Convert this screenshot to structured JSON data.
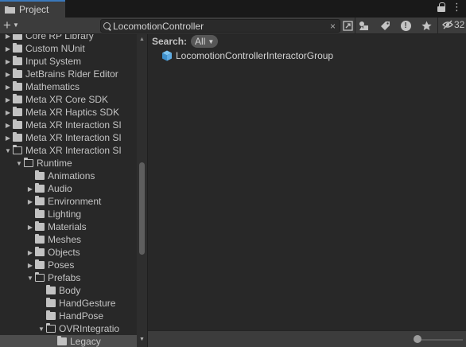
{
  "tab": {
    "label": "Project"
  },
  "toolbar": {
    "search_value": "LocomotionController",
    "clear_glyph": "×",
    "hidden_count": "32"
  },
  "tree": {
    "items": [
      {
        "label": "Core RP Library",
        "depth": 1,
        "expanded": false
      },
      {
        "label": "Custom NUnit",
        "depth": 1,
        "expanded": false
      },
      {
        "label": "Input System",
        "depth": 1,
        "expanded": false
      },
      {
        "label": "JetBrains Rider Editor",
        "depth": 1,
        "expanded": false
      },
      {
        "label": "Mathematics",
        "depth": 1,
        "expanded": false
      },
      {
        "label": "Meta XR Core SDK",
        "depth": 1,
        "expanded": false
      },
      {
        "label": "Meta XR Haptics SDK",
        "depth": 1,
        "expanded": false
      },
      {
        "label": "Meta XR Interaction SI",
        "depth": 1,
        "expanded": false
      },
      {
        "label": "Meta XR Interaction SI",
        "depth": 1,
        "expanded": false
      },
      {
        "label": "Meta XR Interaction SI",
        "depth": 1,
        "expanded": true
      },
      {
        "label": "Runtime",
        "depth": 2,
        "expanded": true
      },
      {
        "label": "Animations",
        "depth": 3,
        "expanded": null
      },
      {
        "label": "Audio",
        "depth": 3,
        "expanded": false
      },
      {
        "label": "Environment",
        "depth": 3,
        "expanded": false
      },
      {
        "label": "Lighting",
        "depth": 3,
        "expanded": null
      },
      {
        "label": "Materials",
        "depth": 3,
        "expanded": false
      },
      {
        "label": "Meshes",
        "depth": 3,
        "expanded": null
      },
      {
        "label": "Objects",
        "depth": 3,
        "expanded": false
      },
      {
        "label": "Poses",
        "depth": 3,
        "expanded": false
      },
      {
        "label": "Prefabs",
        "depth": 3,
        "expanded": true
      },
      {
        "label": "Body",
        "depth": 4,
        "expanded": null
      },
      {
        "label": "HandGesture",
        "depth": 4,
        "expanded": null
      },
      {
        "label": "HandPose",
        "depth": 4,
        "expanded": null
      },
      {
        "label": "OVRIntegratio",
        "depth": 4,
        "expanded": true
      },
      {
        "label": "Legacy",
        "depth": 5,
        "expanded": null,
        "selected": true
      }
    ]
  },
  "main": {
    "search_label": "Search:",
    "scope_value": "All",
    "results": [
      {
        "label": "LocomotionControllerInteractorGroup",
        "icon": "prefab-cube-icon"
      }
    ]
  },
  "colors": {
    "tab_accent": "#3a79bb",
    "prefab_blue": "#4aa3e0",
    "background": "#282828",
    "toolbar": "#3c3c3c"
  }
}
